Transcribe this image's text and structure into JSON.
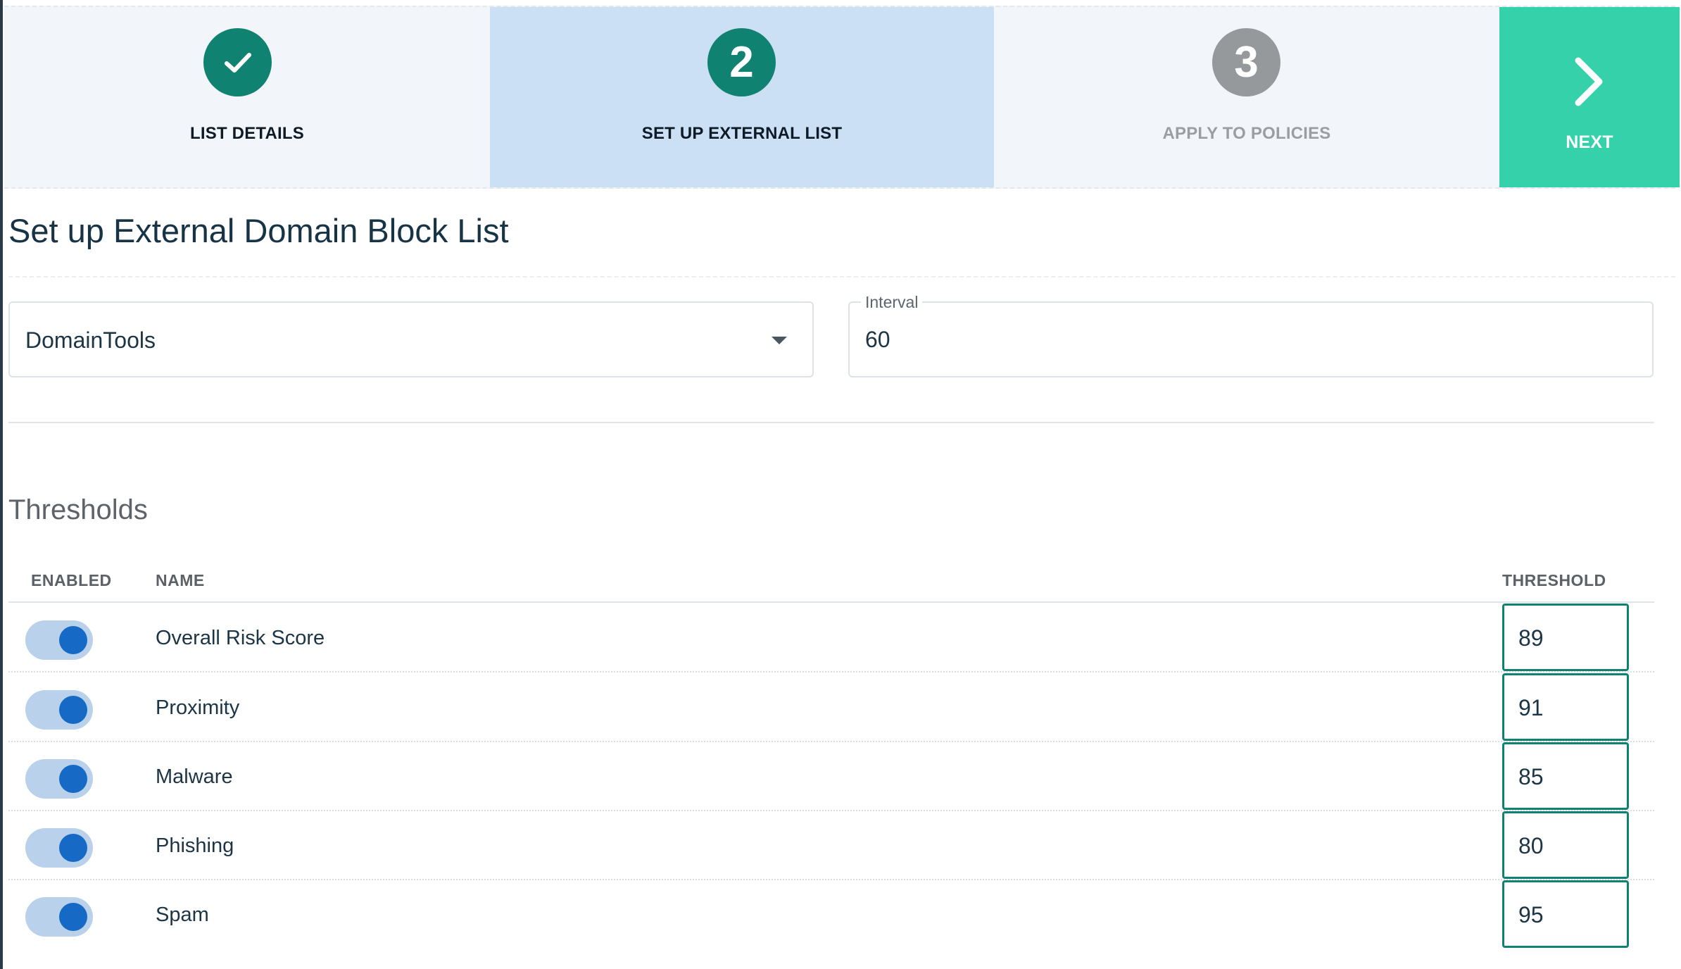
{
  "stepper": {
    "steps": [
      {
        "number": "",
        "label": "LIST DETAILS",
        "state": "completed"
      },
      {
        "number": "2",
        "label": "SET UP EXTERNAL LIST",
        "state": "active"
      },
      {
        "number": "3",
        "label": "APPLY TO POLICIES",
        "state": "upcoming"
      }
    ],
    "next_label": "NEXT"
  },
  "page": {
    "title": "Set up External Domain Block List"
  },
  "form": {
    "provider": {
      "value": "DomainTools"
    },
    "interval": {
      "label": "Interval",
      "value": "60"
    }
  },
  "thresholds": {
    "title": "Thresholds",
    "columns": {
      "enabled": "ENABLED",
      "name": "NAME",
      "threshold": "THRESHOLD"
    },
    "rows": [
      {
        "enabled": true,
        "name": "Overall Risk Score",
        "threshold": "89"
      },
      {
        "enabled": true,
        "name": "Proximity",
        "threshold": "91"
      },
      {
        "enabled": true,
        "name": "Malware",
        "threshold": "85"
      },
      {
        "enabled": true,
        "name": "Phishing",
        "threshold": "80"
      },
      {
        "enabled": true,
        "name": "Spam",
        "threshold": "95"
      }
    ]
  },
  "colors": {
    "accent_teal": "#108272",
    "next_green": "#35d1aa",
    "active_step_bg": "#cbe0f5",
    "toggle_on_knob": "#1669c4"
  }
}
